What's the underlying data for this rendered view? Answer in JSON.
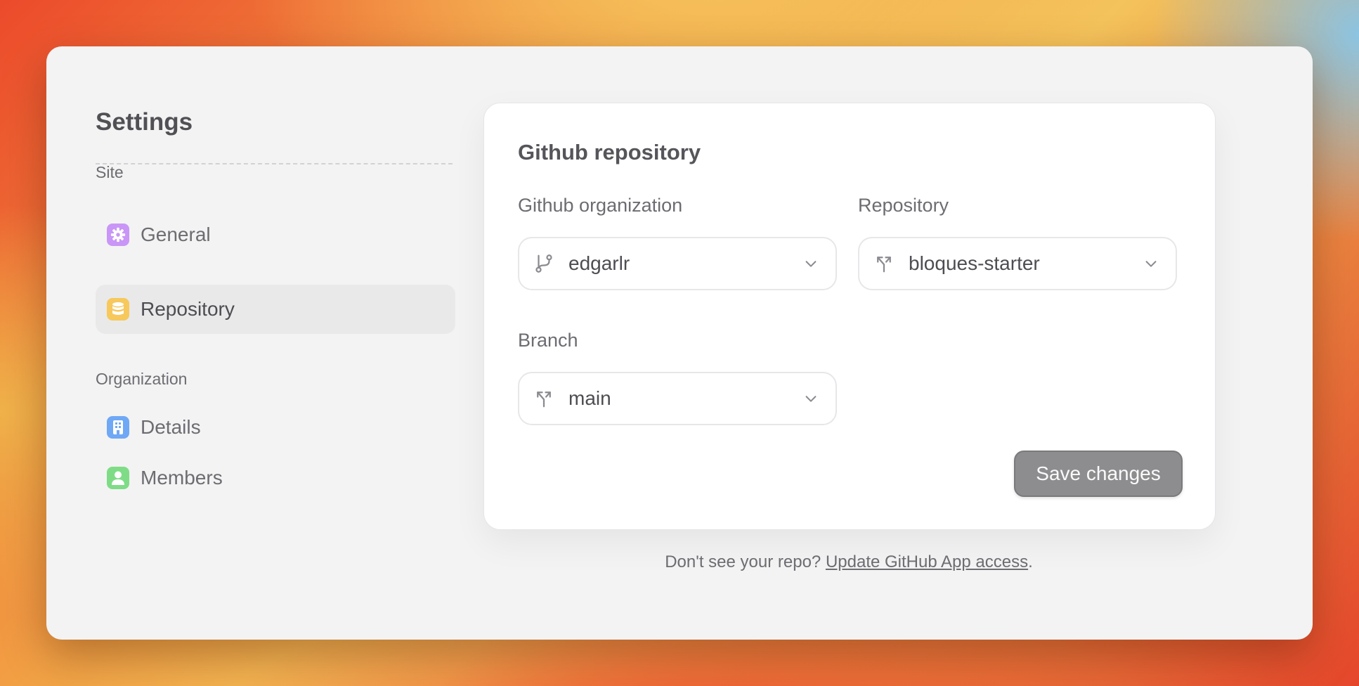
{
  "sidebar": {
    "title": "Settings",
    "sections": [
      {
        "label": "Site",
        "items": [
          {
            "label": "General",
            "icon": "gear-icon",
            "color": "#c996f7",
            "active": false
          },
          {
            "label": "Repository",
            "icon": "database-icon",
            "color": "#f7c85b",
            "active": true
          }
        ]
      },
      {
        "label": "Organization",
        "items": [
          {
            "label": "Details",
            "icon": "building-icon",
            "color": "#6fa8f5",
            "active": false
          },
          {
            "label": "Members",
            "icon": "user-icon",
            "color": "#7fdc86",
            "active": false
          }
        ]
      }
    ]
  },
  "card": {
    "title": "Github repository",
    "fields": {
      "organization": {
        "label": "Github organization",
        "value": "edgarlr",
        "icon": "git-branch-icon"
      },
      "repository": {
        "label": "Repository",
        "value": "bloques-starter",
        "icon": "git-fork-icon"
      },
      "branch": {
        "label": "Branch",
        "value": "main",
        "icon": "git-fork-icon"
      }
    },
    "save_label": "Save changes"
  },
  "footer": {
    "prefix": "Don't see your repo? ",
    "link_label": "Update GitHub App access",
    "suffix": "."
  },
  "colors": {
    "window_bg": "#f3f3f3",
    "card_bg": "#ffffff",
    "save_button": "#8d8d8f",
    "text": "#4d4d52"
  }
}
